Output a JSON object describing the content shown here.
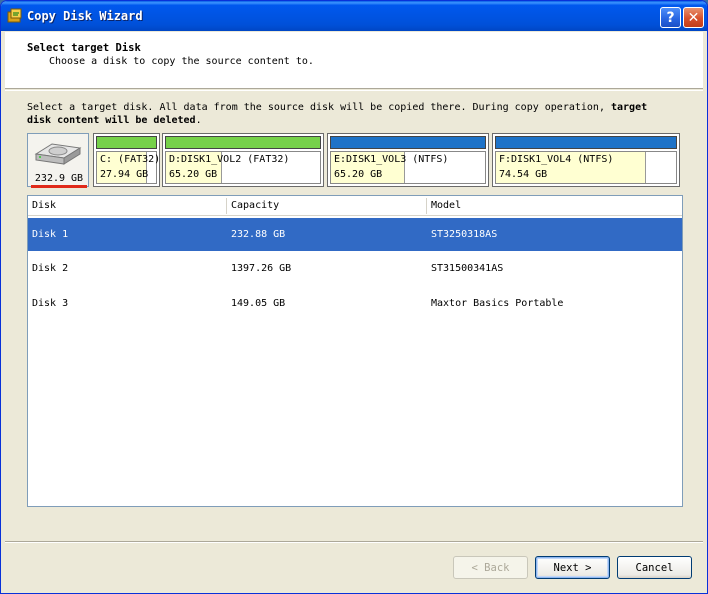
{
  "window": {
    "title": "Copy Disk Wizard"
  },
  "titlebar": {
    "help": "?",
    "close": "✕"
  },
  "header": {
    "title": "Select target Disk",
    "subtitle": "Choose a disk to copy the source content to."
  },
  "instruction": {
    "part1": "Select a target disk. All data from the source disk will be copied there. During copy operation, ",
    "bold1": "target",
    "bold2": "disk content will be deleted",
    "end": "."
  },
  "diskmap": {
    "disk_size": "232.9 GB",
    "partitions": [
      {
        "name": "C: (FAT32)",
        "size": "27.94 GB",
        "color": "green"
      },
      {
        "name": "D:DISK1_VOL2 (FAT32)",
        "size": "65.20 GB",
        "color": "green"
      },
      {
        "name": "E:DISK1_VOL3 (NTFS)",
        "size": "65.20 GB",
        "color": "blue"
      },
      {
        "name": "F:DISK1_VOL4 (NTFS)",
        "size": "74.54 GB",
        "color": "blue"
      }
    ]
  },
  "table": {
    "columns": [
      "Disk",
      "Capacity",
      "Model"
    ],
    "rows": [
      {
        "disk": "Disk 1",
        "capacity": "232.88 GB",
        "model": "ST3250318AS",
        "selected": true
      },
      {
        "disk": "Disk 2",
        "capacity": "1397.26 GB",
        "model": "ST31500341AS",
        "selected": false
      },
      {
        "disk": "Disk 3",
        "capacity": "149.05 GB",
        "model": "Maxtor Basics Portable",
        "selected": false
      }
    ]
  },
  "buttons": {
    "back": "< Back",
    "next": "Next >",
    "cancel": "Cancel"
  },
  "colors": {
    "selection": "#316ac5",
    "fat32_bar": "#76d14a",
    "ntfs_bar": "#1e73c8",
    "disk_marker": "#e02a1a"
  }
}
